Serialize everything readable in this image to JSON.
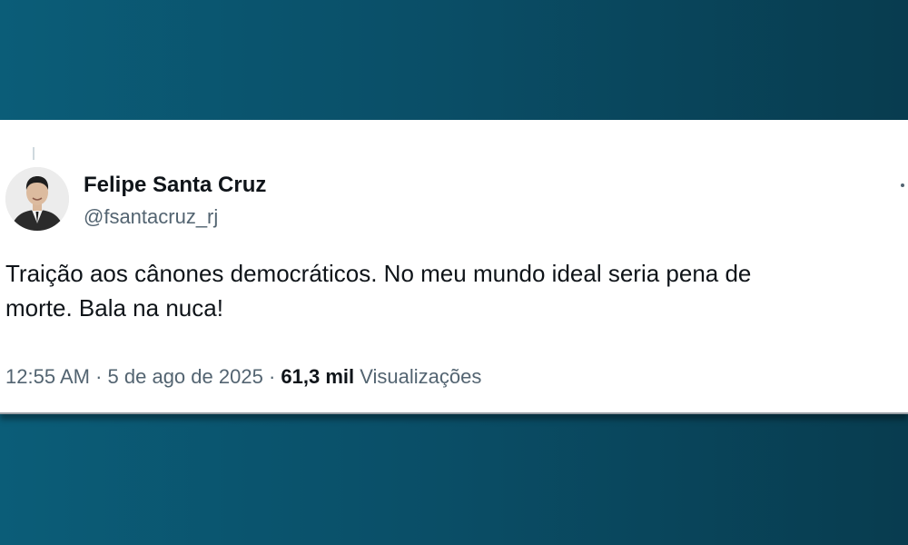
{
  "tweet": {
    "author_name": "Felipe Santa Cruz",
    "author_handle": "@fsantacruz_rj",
    "text_line1": "Traição aos cânones democráticos. No meu mundo ideal seria pena de",
    "text_line2": "morte. Bala na nuca!",
    "time": "12:55 AM",
    "separator": "·",
    "date": "5 de ago de 2025",
    "views_count": "61,3 mil",
    "views_label": "Visualizações",
    "avatar_icon": "user-avatar",
    "more_icon": "more-options-icon"
  },
  "colors": {
    "background_left": "#0b5d78",
    "background_right": "#083c4f",
    "card": "#ffffff",
    "text_primary": "#0f1419",
    "text_secondary": "#536471"
  }
}
